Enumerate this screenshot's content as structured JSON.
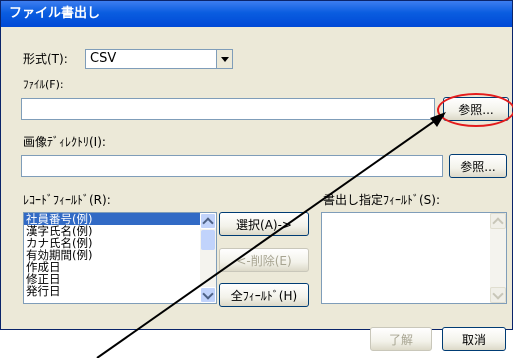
{
  "window": {
    "title": "ファイル書出し"
  },
  "format": {
    "label": "形式(T):",
    "value": "CSV"
  },
  "file": {
    "label": "ﾌｧｲﾙ(F):",
    "value": "",
    "browse_label": "参照..."
  },
  "image_dir": {
    "label": "画像ﾃﾞｨﾚｸﾄﾘ(I):",
    "value": "",
    "browse_label": "参照..."
  },
  "record_fields": {
    "label": "ﾚｺｰﾄﾞﾌｨｰﾙﾄﾞ(R):",
    "items": [
      "社員番号(例)",
      "漢字氏名(例)",
      "カナ氏名(例)",
      "有効期間(例)",
      "作成日",
      "修正日",
      "発行日"
    ]
  },
  "export_fields": {
    "label": "書出し指定ﾌｨｰﾙﾄﾞ(S):",
    "items": []
  },
  "actions": {
    "select_label": "選択(A)->",
    "delete_label": "<-削除(E)",
    "all_fields_label": "全ﾌｨｰﾙﾄﾞ(H)",
    "ok_label": "了解",
    "cancel_label": "取消"
  },
  "annotation": {
    "highlight_color": "#e41c1c",
    "arrow_color": "#000000"
  }
}
